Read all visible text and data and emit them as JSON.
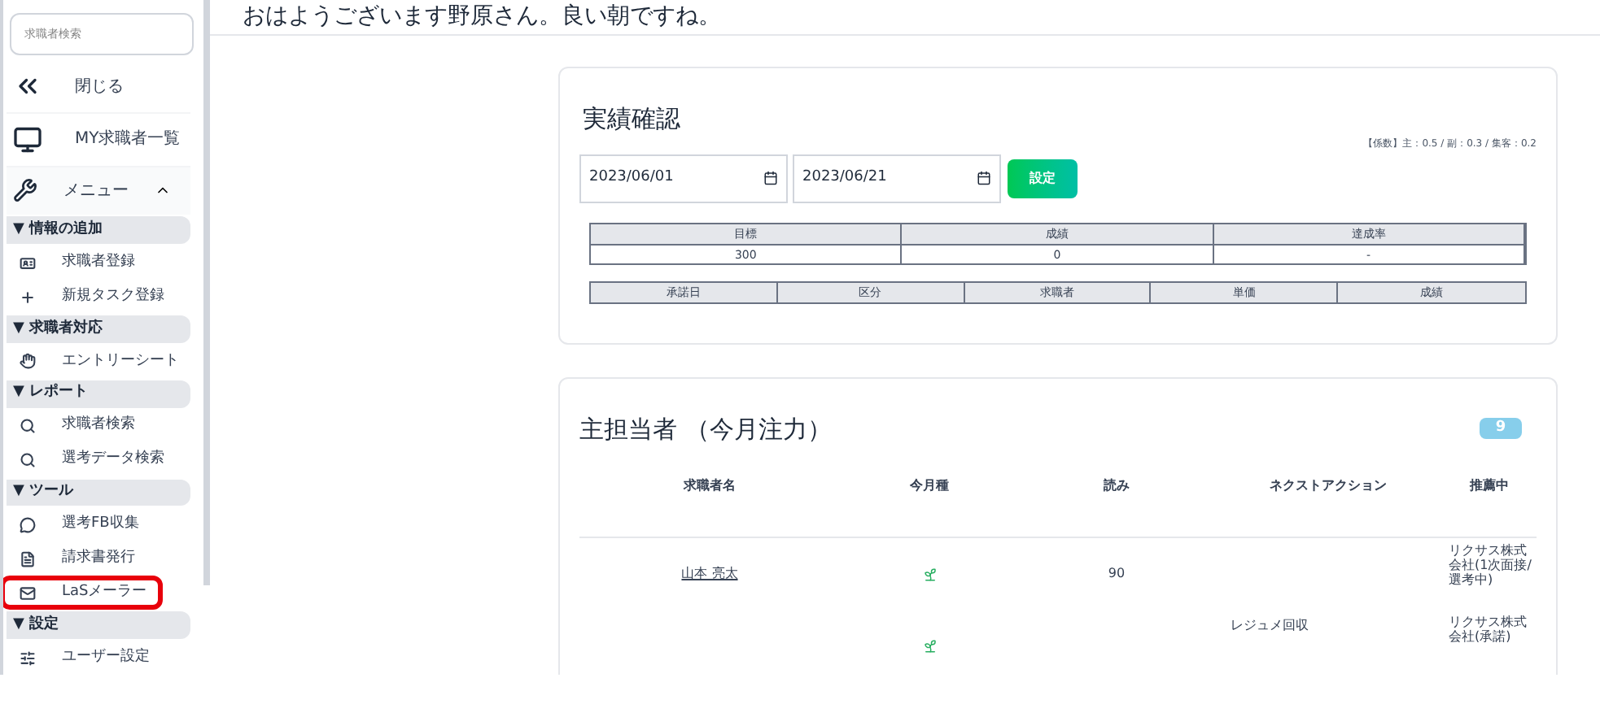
{
  "sidebar": {
    "search": {
      "placeholder": "求職者検索"
    },
    "items": [
      {
        "kind": "nav",
        "label": "閉じる"
      },
      {
        "kind": "nav",
        "label": "MY求職者一覧"
      },
      {
        "kind": "menu",
        "label": "メニュー",
        "expanded": true
      },
      {
        "kind": "section",
        "label": "▼ 情報の追加"
      },
      {
        "kind": "item",
        "label": "求職者登録",
        "highlighted": false
      },
      {
        "kind": "item",
        "label": "新規タスク登録",
        "highlighted": false
      },
      {
        "kind": "section",
        "label": "▼ 求職者対応"
      },
      {
        "kind": "item",
        "label": "エントリーシート",
        "highlighted": false
      },
      {
        "kind": "section",
        "label": "▼ レポート"
      },
      {
        "kind": "item",
        "label": "求職者検索",
        "highlighted": false
      },
      {
        "kind": "item",
        "label": "選考データ検索",
        "highlighted": false
      },
      {
        "kind": "section",
        "label": "▼ ツール"
      },
      {
        "kind": "item",
        "label": "選考FB収集",
        "highlighted": false
      },
      {
        "kind": "item",
        "label": "請求書発行",
        "highlighted": false
      },
      {
        "kind": "item",
        "label": "LaSメーラー",
        "highlighted": true
      },
      {
        "kind": "section",
        "label": "▼ 設定"
      },
      {
        "kind": "item",
        "label": "ユーザー設定",
        "highlighted": false
      }
    ]
  },
  "greeting": "おはようございます野原さん。良い朝ですね。",
  "performance": {
    "title": "実績確認",
    "coefficients": "【係数】主：0.5 / 副：0.3 / 集客：0.2",
    "start_date": "2023/06/01",
    "end_date": "2023/06/21",
    "set_button": "設定",
    "summary": {
      "columns": [
        "目標",
        "成績",
        "達成率"
      ],
      "values": [
        "300",
        "0",
        "-"
      ]
    },
    "detail_columns": [
      "承諾日",
      "区分",
      "求職者",
      "単価",
      "成績"
    ]
  },
  "main_contact": {
    "title": "主担当者 （今月注力）",
    "count": "9",
    "columns": [
      "求職者名",
      "今月種",
      "読み",
      "ネクストアクション",
      "推薦中"
    ],
    "rows": [
      {
        "name": "山本 亮太",
        "seed": true,
        "reading": "90",
        "next_action": "",
        "recommending": "リクサス株式会社(1次面接/選考中)"
      },
      {
        "name": "",
        "seed": true,
        "reading": "",
        "next_action": "レジュメ回収",
        "recommending": "リクサス株式会社(承諾)"
      }
    ]
  }
}
